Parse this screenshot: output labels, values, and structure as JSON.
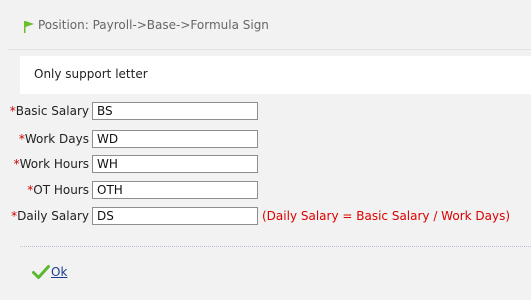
{
  "breadcrumb": {
    "text": "Position: Payroll->Base->Formula Sign"
  },
  "notice": {
    "text": "Only support letter"
  },
  "form": {
    "required_mark": "*",
    "fields": [
      {
        "label": "Basic Salary",
        "value": "BS"
      },
      {
        "label": "Work Days",
        "value": "WD"
      },
      {
        "label": "Work Hours",
        "value": "WH"
      },
      {
        "label": "OT Hours",
        "value": "OTH"
      },
      {
        "label": "Daily Salary",
        "value": "DS"
      }
    ],
    "daily_salary_hint": "(Daily Salary = Basic Salary / Work Days)"
  },
  "actions": {
    "ok_label": "Ok"
  },
  "colors": {
    "required": "#cc0000",
    "hint": "#dd0000",
    "flag": "#6bbf2b",
    "check": "#5cb82e",
    "link": "#1a3d8f"
  },
  "icons": {
    "breadcrumb": "flag-icon",
    "ok": "check-icon"
  }
}
